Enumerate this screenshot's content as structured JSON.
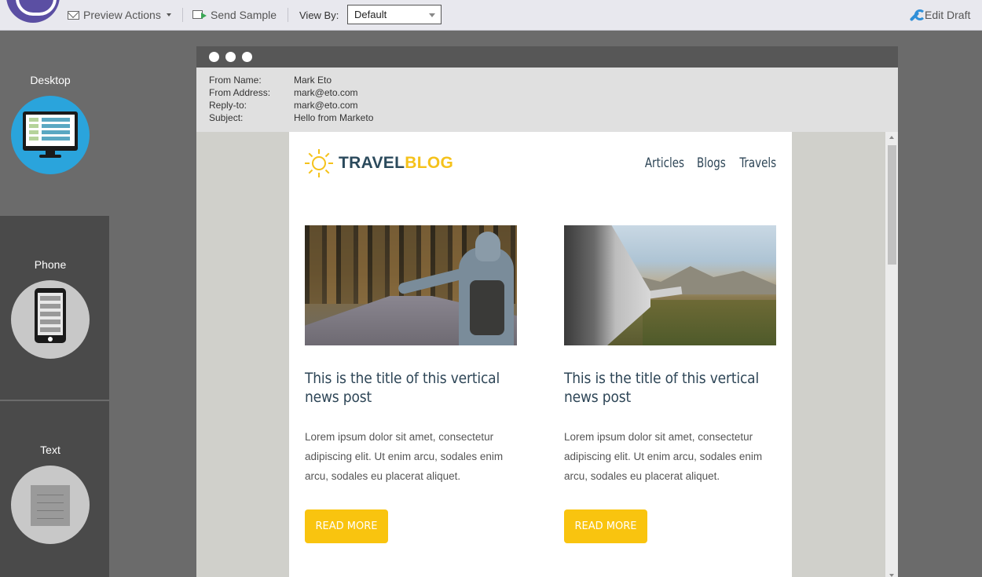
{
  "toolbar": {
    "preview_actions": "Preview Actions",
    "send_sample": "Send Sample",
    "view_by_label": "View By:",
    "view_by_value": "Default",
    "edit_draft": "Edit Draft"
  },
  "devices": [
    {
      "label": "Desktop",
      "icon": "desktop-icon",
      "active": true
    },
    {
      "label": "Phone",
      "icon": "phone-icon",
      "active": false
    },
    {
      "label": "Text",
      "icon": "text-document-icon",
      "active": false
    }
  ],
  "email_headers": {
    "from_name_label": "From Name:",
    "from_name": "Mark Eto",
    "from_address_label": "From Address:",
    "from_address": "mark@eto.com",
    "reply_to_label": "Reply-to:",
    "reply_to": "mark@eto.com",
    "subject_label": "Subject:",
    "subject": "Hello from Marketo"
  },
  "email": {
    "brand_part1": "TRAVEL",
    "brand_part2": "BLOG",
    "nav": [
      "Articles",
      "Blogs",
      "Travels"
    ],
    "posts": [
      {
        "title_line1": "This is the title of this vertical",
        "title_line2": "news post",
        "body": "Lorem ipsum dolor sit amet, consectetur adipiscing elit. Ut enim arcu, sodales enim arcu, sodales eu placerat aliquet.",
        "button": "READ MORE"
      },
      {
        "title_line1": "This is the title of this vertical",
        "title_line2": "news post",
        "body": "Lorem ipsum dolor sit amet, consectetur adipiscing elit. Ut enim arcu, sodales enim arcu, sodales eu placerat aliquet.",
        "button": "READ MORE"
      }
    ]
  },
  "colors": {
    "accent_blue": "#2aa4dc",
    "brand_yellow": "#f5c21b",
    "button_yellow": "#f9c40f",
    "heading_navy": "#2d4556"
  }
}
